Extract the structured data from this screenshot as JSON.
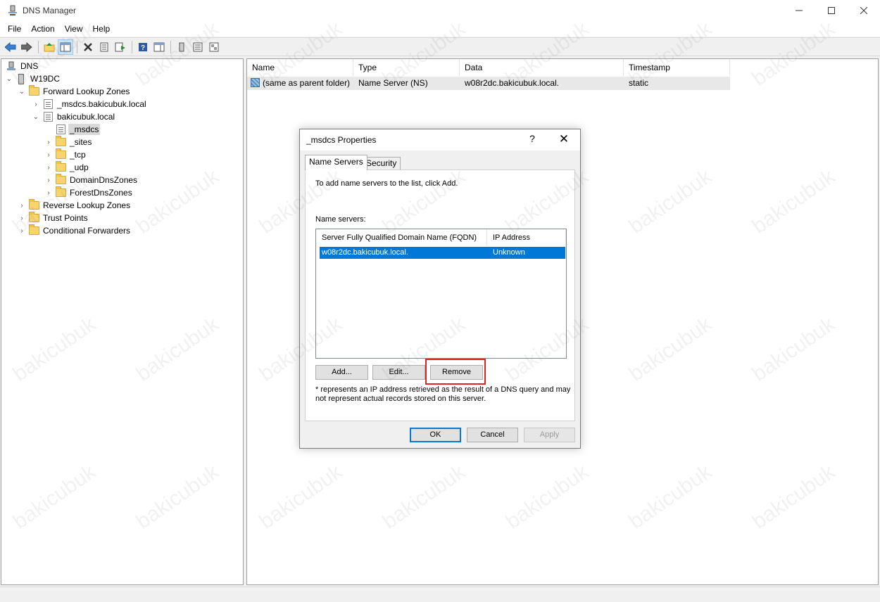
{
  "window": {
    "title": "DNS Manager"
  },
  "menu": [
    "File",
    "Action",
    "View",
    "Help"
  ],
  "tree": {
    "root": "DNS",
    "server": "W19DC",
    "forward_zones": "Forward Lookup Zones",
    "msdcs_zone": "_msdcs.bakicubuk.local",
    "domain_zone": "bakicubuk.local",
    "msdcs_child": "_msdcs",
    "sites": "_sites",
    "tcp": "_tcp",
    "udp": "_udp",
    "domain_dns": "DomainDnsZones",
    "forest_dns": "ForestDnsZones",
    "reverse_zones": "Reverse Lookup Zones",
    "trust_points": "Trust Points",
    "cond_forwarders": "Conditional Forwarders"
  },
  "list": {
    "columns": [
      "Name",
      "Type",
      "Data",
      "Timestamp"
    ],
    "rows": [
      [
        "(same as parent folder)",
        "Name Server (NS)",
        "w08r2dc.bakicubuk.local.",
        "static"
      ]
    ]
  },
  "dialog": {
    "title": "_msdcs Properties",
    "help": "?",
    "close": "✕",
    "tabs": [
      "Name Servers",
      "Security"
    ],
    "info": "To add name servers to the list, click Add.",
    "ns_label": "Name servers:",
    "ns_columns": [
      "Server Fully Qualified Domain Name (FQDN)",
      "IP Address"
    ],
    "ns_rows": [
      [
        "w08r2dc.bakicubuk.local.",
        "Unknown"
      ]
    ],
    "add": "Add...",
    "edit": "Edit...",
    "remove": "Remove",
    "note": "* represents an IP address retrieved as the result of a DNS query and may not represent actual records stored on this server.",
    "ok": "OK",
    "cancel": "Cancel",
    "apply": "Apply"
  },
  "watermark": "bakicubuk"
}
